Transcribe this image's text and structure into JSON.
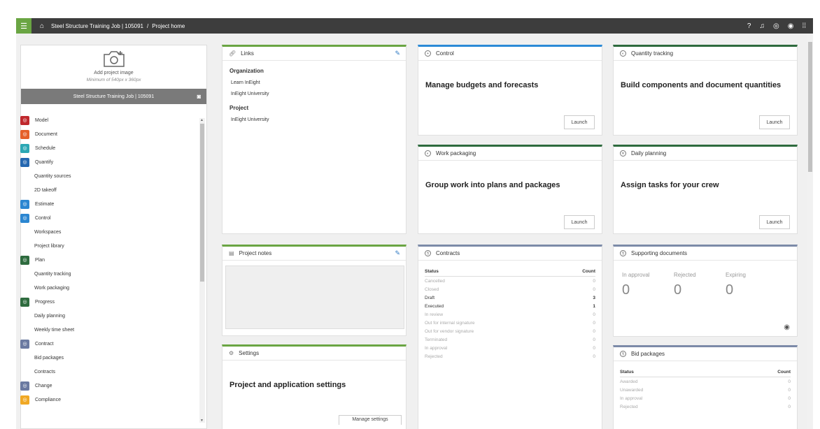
{
  "topbar": {
    "breadcrumb_job": "Steel Structure Training Job | 105091",
    "breadcrumb_sep": "/",
    "breadcrumb_page": "Project home",
    "icons": [
      "help-icon",
      "bell-icon",
      "user-icon",
      "record-icon",
      "grid-icon"
    ]
  },
  "project_image": {
    "title": "Add project image",
    "subtitle": "Minimum of 540px x 360px",
    "job_name": "Steel Structure Training Job | 105091"
  },
  "nav": [
    {
      "label": "Model",
      "type": "main",
      "color": "#c0282d"
    },
    {
      "label": "Document",
      "type": "main",
      "color": "#e5602a"
    },
    {
      "label": "Schedule",
      "type": "main",
      "color": "#2ba7b4"
    },
    {
      "label": "Quantify",
      "type": "main",
      "color": "#2467b0"
    },
    {
      "label": "Quantity sources",
      "type": "sub"
    },
    {
      "label": "2D takeoff",
      "type": "sub"
    },
    {
      "label": "Estimate",
      "type": "main",
      "color": "#2b86d1"
    },
    {
      "label": "Control",
      "type": "main",
      "color": "#2b86d1"
    },
    {
      "label": "Workspaces",
      "type": "sub"
    },
    {
      "label": "Project library",
      "type": "sub"
    },
    {
      "label": "Plan",
      "type": "main",
      "color": "#2e6b3e"
    },
    {
      "label": "Quantity tracking",
      "type": "sub"
    },
    {
      "label": "Work packaging",
      "type": "sub"
    },
    {
      "label": "Progress",
      "type": "main",
      "color": "#2e6b3e"
    },
    {
      "label": "Daily planning",
      "type": "sub"
    },
    {
      "label": "Weekly time sheet",
      "type": "sub"
    },
    {
      "label": "Contract",
      "type": "main",
      "color": "#6b7aa1"
    },
    {
      "label": "Bid packages",
      "type": "sub"
    },
    {
      "label": "Contracts",
      "type": "sub"
    },
    {
      "label": "Change",
      "type": "main",
      "color": "#6b7aa1"
    },
    {
      "label": "Compliance",
      "type": "main",
      "color": "#f0a824"
    }
  ],
  "links": {
    "title": "Links",
    "org_heading": "Organization",
    "org_links": [
      "Learn InEight",
      "InEight University"
    ],
    "project_heading": "Project",
    "project_links": [
      "InEight University"
    ]
  },
  "project_notes": {
    "title": "Project notes"
  },
  "settings": {
    "title": "Settings",
    "heading": "Project and application settings",
    "button": "Manage settings"
  },
  "control": {
    "title": "Control",
    "heading": "Manage budgets and forecasts",
    "button": "Launch"
  },
  "work_packaging": {
    "title": "Work packaging",
    "heading": "Group work into plans and packages",
    "button": "Launch"
  },
  "quantity_tracking": {
    "title": "Quantity tracking",
    "heading": "Build components and document quantities",
    "button": "Launch"
  },
  "daily_planning": {
    "title": "Daily planning",
    "heading": "Assign tasks for your crew",
    "button": "Launch"
  },
  "contracts": {
    "title": "Contracts",
    "col_status": "Status",
    "col_count": "Count",
    "rows": [
      {
        "status": "Cancelled",
        "count": "0"
      },
      {
        "status": "Closed",
        "count": "0"
      },
      {
        "status": "Draft",
        "count": "3"
      },
      {
        "status": "Executed",
        "count": "1"
      },
      {
        "status": "In review",
        "count": "0"
      },
      {
        "status": "Out for internal signature",
        "count": "0"
      },
      {
        "status": "Out for vendor signature",
        "count": "0"
      },
      {
        "status": "Terminated",
        "count": "0"
      },
      {
        "status": "In approval",
        "count": "0"
      },
      {
        "status": "Rejected",
        "count": "0"
      }
    ]
  },
  "supporting_documents": {
    "title": "Supporting documents",
    "cols": [
      {
        "label": "In approval",
        "value": "0"
      },
      {
        "label": "Rejected",
        "value": "0"
      },
      {
        "label": "Expiring",
        "value": "0"
      }
    ]
  },
  "bid_packages": {
    "title": "Bid packages",
    "col_status": "Status",
    "col_count": "Count",
    "rows": [
      {
        "status": "Awarded",
        "count": "0"
      },
      {
        "status": "Unawarded",
        "count": "0"
      },
      {
        "status": "In approval",
        "count": "0"
      },
      {
        "status": "Rejected",
        "count": "0"
      }
    ]
  }
}
